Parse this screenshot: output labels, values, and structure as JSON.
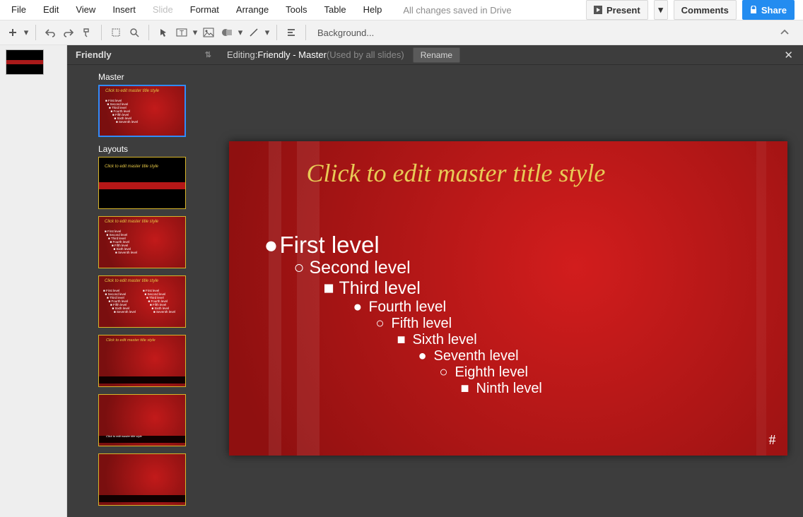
{
  "menu": {
    "file": "File",
    "edit": "Edit",
    "view": "View",
    "insert": "Insert",
    "slide": "Slide",
    "format": "Format",
    "arrange": "Arrange",
    "tools": "Tools",
    "table": "Table",
    "help": "Help",
    "status": "All changes saved in Drive"
  },
  "buttons": {
    "present": "Present",
    "comments": "Comments",
    "share": "Share",
    "rename": "Rename"
  },
  "toolbar": {
    "background": "Background..."
  },
  "panel": {
    "theme": "Friendly",
    "master_label": "Master",
    "layouts_label": "Layouts",
    "thumb_title": "Click to edit master title style",
    "thumb_lines": "■ First level\n  ■ Second level\n    ■ Third level\n      ■ Fourth level\n        ■ Fifth level\n          ■ Sixth level\n            ■ Seventh level"
  },
  "editbar": {
    "prefix": "Editing: ",
    "name": "Friendly - Master",
    "used": " (Used by all slides)"
  },
  "slide": {
    "title": "Click to edit master title style",
    "levels": [
      {
        "b": "●",
        "t": "First level"
      },
      {
        "b": "○",
        "t": "Second level"
      },
      {
        "b": "■",
        "t": "Third level"
      },
      {
        "b": "●",
        "t": "Fourth level"
      },
      {
        "b": "○",
        "t": "Fifth level"
      },
      {
        "b": "■",
        "t": "Sixth level"
      },
      {
        "b": "●",
        "t": "Seventh level"
      },
      {
        "b": "○",
        "t": "Eighth level"
      },
      {
        "b": "■",
        "t": "Ninth level"
      }
    ],
    "page": "#"
  }
}
